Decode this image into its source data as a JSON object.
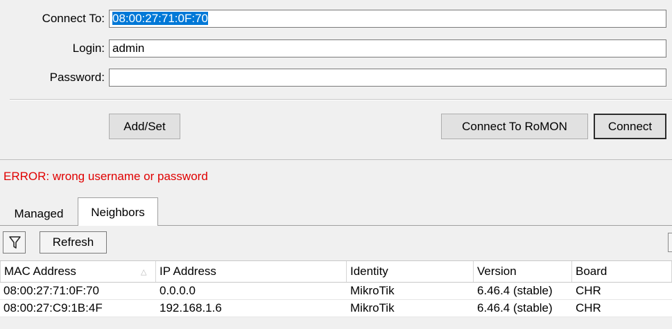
{
  "form": {
    "connect_to_label": "Connect To:",
    "connect_to_value": "08:00:27:71:0F:70",
    "login_label": "Login:",
    "login_value": "admin",
    "password_label": "Password:",
    "password_value": ""
  },
  "buttons": {
    "add_set": "Add/Set",
    "connect_romon": "Connect To RoMON",
    "connect": "Connect"
  },
  "error_message": "ERROR: wrong username or password",
  "tabs": [
    {
      "label": "Managed",
      "active": false
    },
    {
      "label": "Neighbors",
      "active": true
    }
  ],
  "toolbar": {
    "filter_icon": "filter-icon",
    "refresh_label": "Refresh"
  },
  "table": {
    "columns": [
      "MAC Address",
      "IP Address",
      "Identity",
      "Version",
      "Board"
    ],
    "sort_column": "MAC Address",
    "rows": [
      [
        "08:00:27:71:0F:70",
        "0.0.0.0",
        "MikroTik",
        "6.46.4 (stable)",
        "CHR"
      ],
      [
        "08:00:27:C9:1B:4F",
        "192.168.1.6",
        "MikroTik",
        "6.46.4 (stable)",
        "CHR"
      ]
    ]
  },
  "colors": {
    "error": "#e00000",
    "selection": "#0078d7"
  }
}
